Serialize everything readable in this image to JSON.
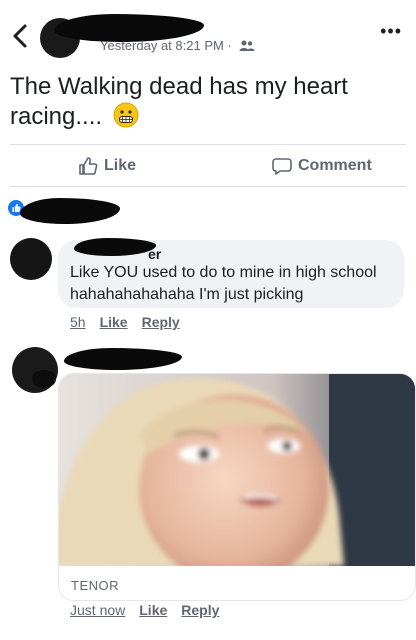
{
  "header": {
    "meta_text": "Yesterday at 8:21 PM · ",
    "icons": [
      "back-chevron-icon",
      "friends-icon",
      "more-icon"
    ]
  },
  "post": {
    "text": "The Walking dead has my heart racing....",
    "emoji": "grimacing-face"
  },
  "actions": {
    "like_label": "Like",
    "comment_label": "Comment"
  },
  "comment1": {
    "name_tail": "er",
    "text": "Like YOU used to do to mine in high school hahahahahahaha I'm just picking",
    "time": "5h",
    "like_label": "Like",
    "reply_label": "Reply"
  },
  "comment2": {
    "gif_source": "TENOR",
    "time": "Just now",
    "like_label": "Like",
    "reply_label": "Reply"
  },
  "colors": {
    "text": "#1c1e21",
    "secondary": "#606770",
    "bubble": "#f0f2f5",
    "divider": "#dadde1"
  }
}
